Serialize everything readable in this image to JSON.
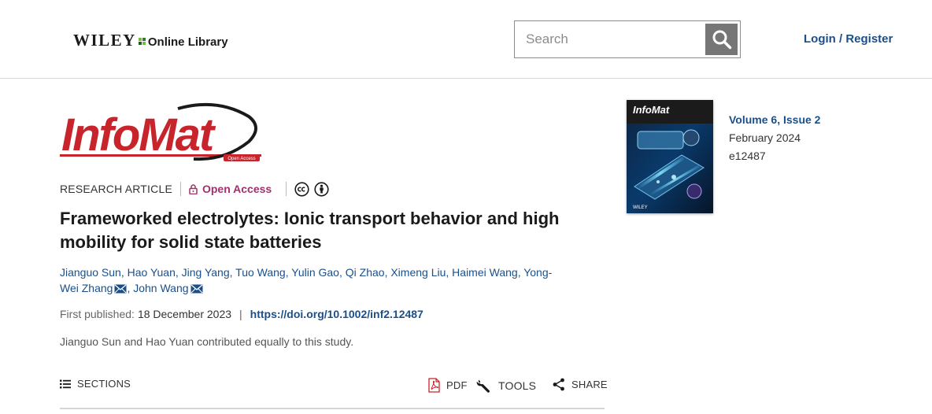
{
  "header": {
    "brand_name": "WILEY",
    "brand_suffix": "Online Library",
    "search_placeholder": "Search",
    "login_label": "Login / Register"
  },
  "journal": {
    "logo_text": "InfoMat",
    "logo_badge": "Open Access",
    "cover_title": "InfoMat",
    "cover_publisher": "WILEY"
  },
  "article": {
    "type": "RESEARCH ARTICLE",
    "access": "Open Access",
    "title": "Frameworked electrolytes: Ionic transport behavior and high mobility for solid state batteries",
    "authors": [
      {
        "name": "Jianguo Sun",
        "sep": ", "
      },
      {
        "name": "Hao Yuan",
        "sep": ", "
      },
      {
        "name": "Jing Yang",
        "sep": ", "
      },
      {
        "name": "Tuo Wang",
        "sep": ", "
      },
      {
        "name": "Yulin Gao",
        "sep": ", "
      },
      {
        "name": "Qi Zhao",
        "sep": ", "
      },
      {
        "name": "Ximeng Liu",
        "sep": ", "
      },
      {
        "name": "Haimei Wang",
        "sep": ", "
      },
      {
        "name": "Yong-Wei Zhang",
        "sep": ", ",
        "corresponding": true
      },
      {
        "name": "John Wang",
        "sep": "",
        "corresponding": true
      }
    ],
    "first_published_label": "First published:",
    "first_published_date": "18 December 2023",
    "doi": "https://doi.org/10.1002/inf2.12487",
    "contribution_note": "Jianguo Sun and Hao Yuan contributed equally to this study."
  },
  "issue": {
    "volume": "Volume 6, Issue 2",
    "date": "February 2024",
    "article_number": "e12487"
  },
  "toolbar": {
    "sections_label": "SECTIONS",
    "pdf_label": "PDF",
    "tools_label": "TOOLS",
    "share_label": "SHARE"
  },
  "colors": {
    "link": "#1b4f8a",
    "open_access": "#a1306d",
    "logo_red": "#c8242b",
    "search_button": "#767676"
  },
  "icons": [
    "search-icon",
    "lock-icon",
    "cc-icon",
    "attribution-icon",
    "mail-icon",
    "list-icon",
    "pdf-icon",
    "wrench-icon",
    "share-icon"
  ]
}
